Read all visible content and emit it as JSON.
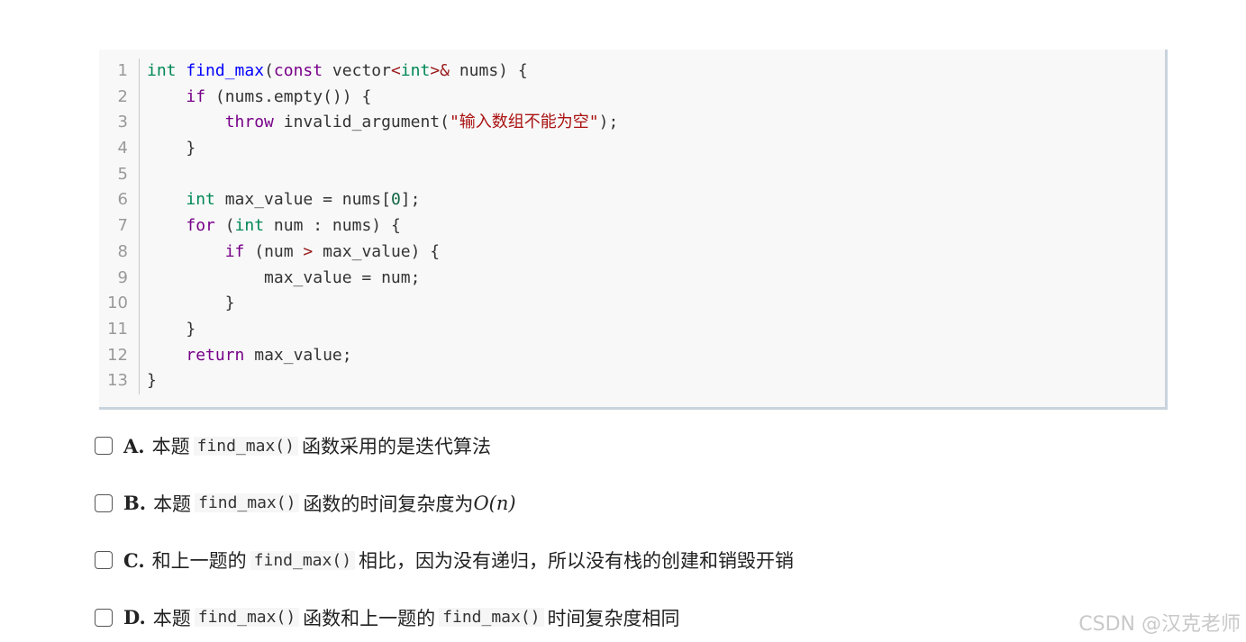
{
  "code": {
    "lines": [
      {
        "n": "1"
      },
      {
        "n": "2"
      },
      {
        "n": "3"
      },
      {
        "n": "4"
      },
      {
        "n": "5"
      },
      {
        "n": "6"
      },
      {
        "n": "7"
      },
      {
        "n": "8"
      },
      {
        "n": "9"
      },
      {
        "n": "10"
      },
      {
        "n": "11"
      },
      {
        "n": "12"
      },
      {
        "n": "13"
      }
    ],
    "tok": {
      "int": "int",
      "find_max": "find_max",
      "l1_open": "(",
      "const": "const",
      "vector": " vector",
      "lt": "<",
      "gt": ">",
      "amp": "&",
      "l1_rest": " nums) {",
      "if": "if",
      "l2_rest": " (nums.empty()) {",
      "throw": "throw",
      "l3_mid": " invalid_argument(",
      "l3_str": "\"输入数组不能为空\"",
      "l3_end": ");",
      "close_brace": "}",
      "l6_rest": " max_value = nums[",
      "zero": "0",
      "l6_end": "];",
      "for": "for",
      "l7_open": " (",
      "l7_rest": " num : nums) {",
      "l8_open": " (num ",
      "l8_rest": " max_value) {",
      "l9": "max_value = num;",
      "return": "return",
      "l12_rest": " max_value;"
    }
  },
  "options": [
    {
      "letter": "A.",
      "pre": "本题",
      "code": "find_max()",
      "post": "函数采用的是迭代算法"
    },
    {
      "letter": "B.",
      "pre": "本题",
      "code": "find_max()",
      "post": "函数的时间复杂度为",
      "math": "O(n)"
    },
    {
      "letter": "C.",
      "pre": "和上一题的",
      "code": "find_max()",
      "post": "相比，因为没有递归，所以没有栈的创建和销毁开销"
    },
    {
      "letter": "D.",
      "pre": "本题",
      "code": "find_max()",
      "post": "函数和上一题的",
      "code2": "find_max()",
      "post2": "时间复杂度相同"
    }
  ],
  "watermark": "CSDN @汉克老师"
}
